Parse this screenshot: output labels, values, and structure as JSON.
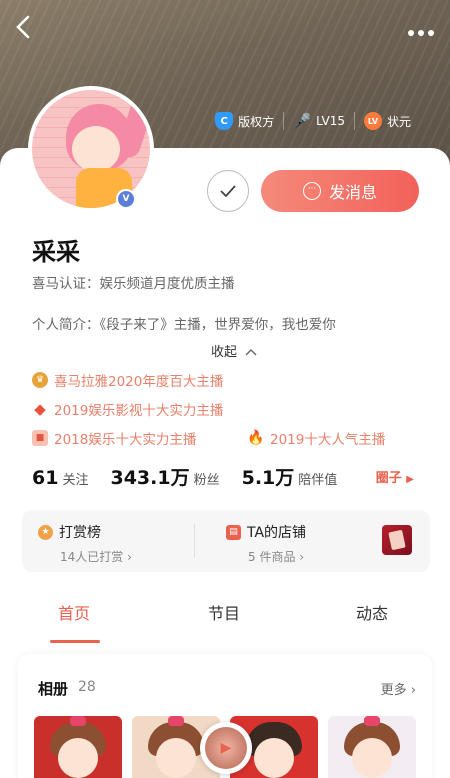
{
  "header": {
    "back_icon": "chevron-left-icon",
    "more_icon": "more-dots-icon",
    "badges": [
      {
        "icon": "copyright-shield-icon",
        "label": "版权方"
      },
      {
        "icon": "microphone-icon",
        "label": "LV15"
      },
      {
        "icon": "level-icon",
        "label": "状元"
      }
    ]
  },
  "profile": {
    "name": "采采",
    "verify_badge": "V",
    "certification": "喜马认证：娱乐频道月度优质主播",
    "intro": "个人简介：《段子来了》主播，世界爱你，我也爱你",
    "collapse_label": "收起",
    "message_button": "发消息",
    "follow_icon": "check-icon"
  },
  "awards": [
    {
      "icon": "crown-badge-icon",
      "label": "喜马拉雅2020年度百大主播",
      "color": "#e8a23a"
    },
    {
      "icon": "diamond-icon",
      "label": "2019娱乐影视十大实力主播",
      "color": "#e8523f"
    },
    {
      "icon": "medal-icon",
      "label": "2018娱乐十大实力主播",
      "color": "#f08b72"
    },
    {
      "icon": "flame-icon",
      "label": "2019十大人气主播",
      "color": "#e8523f"
    }
  ],
  "stats": [
    {
      "value": "61",
      "label": "关注"
    },
    {
      "value": "343.1万",
      "label": "粉丝"
    },
    {
      "value": "5.1万",
      "label": "陪伴值"
    }
  ],
  "circle_link": "圈子",
  "panel": {
    "reward": {
      "icon": "star-coin-icon",
      "title": "打赏榜",
      "subtitle": "14人已打赏"
    },
    "shop": {
      "icon": "shop-icon",
      "title": "TA的店铺",
      "subtitle": "5 件商品"
    }
  },
  "tabs": [
    {
      "label": "首页",
      "active": true
    },
    {
      "label": "节目",
      "active": false
    },
    {
      "label": "动态",
      "active": false
    }
  ],
  "album": {
    "title": "相册",
    "count": "28",
    "more": "更多"
  },
  "colors": {
    "accent": "#e8624f",
    "button_gradient_start": "#f58a7a",
    "button_gradient_end": "#f2615a"
  }
}
